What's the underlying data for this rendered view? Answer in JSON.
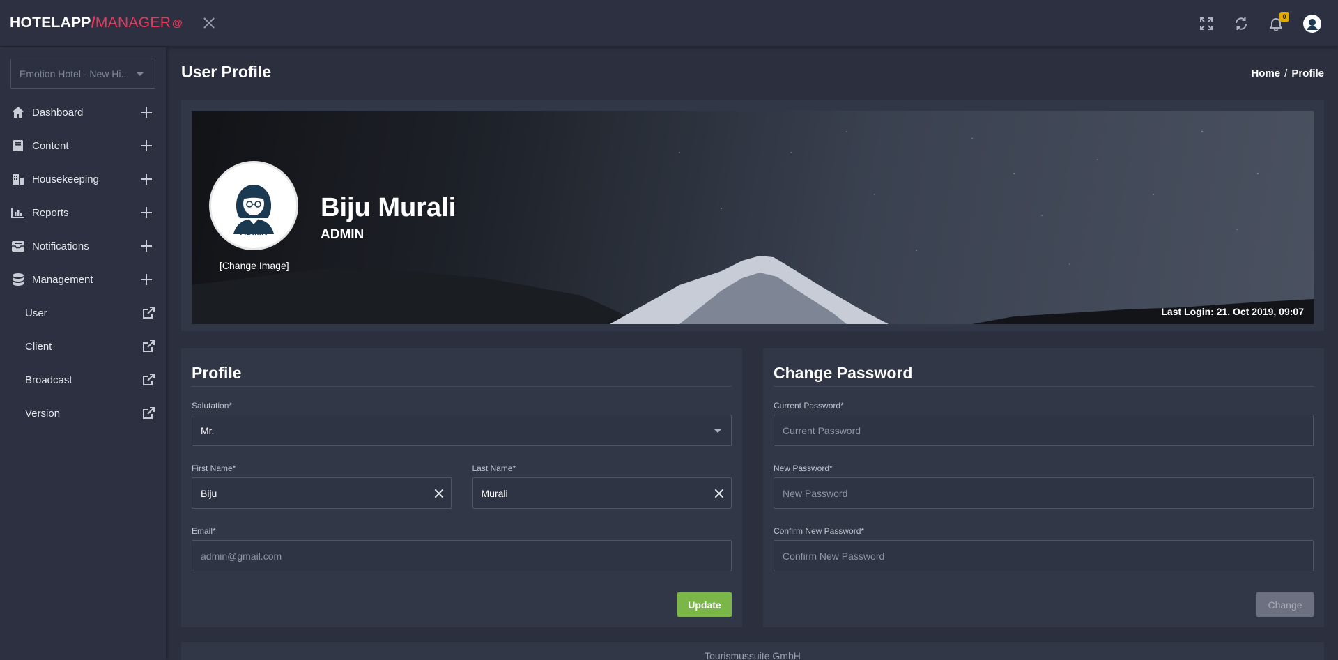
{
  "app": {
    "logo_part1": "HOTELAPP",
    "logo_sep": "/",
    "logo_part2": "MANAGER",
    "logo_mark": "@",
    "notification_count": "0"
  },
  "icons": {
    "fullscreen": "fullscreen-icon",
    "refresh": "refresh-icon",
    "bell": "bell-icon",
    "user": "user-avatar-icon"
  },
  "colors": {
    "accent": "#e8395a",
    "update_button": "#7ab648",
    "badge": "#e0a800",
    "background": "#2b2f3e",
    "panel": "#323748"
  },
  "sidebar": {
    "hotel_select": "Emotion Hotel - New Hi...",
    "items": [
      {
        "label": "Dashboard",
        "icon": "home-icon"
      },
      {
        "label": "Content",
        "icon": "book-icon"
      },
      {
        "label": "Housekeeping",
        "icon": "building-icon"
      },
      {
        "label": "Reports",
        "icon": "bar-chart-icon"
      },
      {
        "label": "Notifications",
        "icon": "inbox-icon"
      },
      {
        "label": "Management",
        "icon": "database-icon"
      }
    ],
    "sub_items": [
      {
        "label": "User"
      },
      {
        "label": "Client"
      },
      {
        "label": "Broadcast"
      },
      {
        "label": "Version"
      }
    ]
  },
  "page": {
    "title": "User Profile",
    "breadcrumb_home": "Home",
    "breadcrumb_sep": "/",
    "breadcrumb_current": "Profile"
  },
  "hero": {
    "name": "Biju Murali",
    "role": "ADMIN",
    "avatar_label": "ADMIN",
    "change_image": "[Change Image]",
    "last_login": "Last Login: 21. Oct 2019, 09:07"
  },
  "profile": {
    "heading": "Profile",
    "salutation_label": "Salutation*",
    "salutation_value": "Mr.",
    "first_name_label": "First Name*",
    "first_name_value": "Biju",
    "last_name_label": "Last Name*",
    "last_name_value": "Murali",
    "email_label": "Email*",
    "email_value": "admin@gmail.com",
    "update_button": "Update"
  },
  "password": {
    "heading": "Change Password",
    "current_label": "Current Password*",
    "current_placeholder": "Current Password",
    "new_label": "New Password*",
    "new_placeholder": "New Password",
    "confirm_label": "Confirm New Password*",
    "confirm_placeholder": "Confirm New Password",
    "change_button": "Change"
  },
  "footer": {
    "text": "Tourismussuite GmbH"
  }
}
